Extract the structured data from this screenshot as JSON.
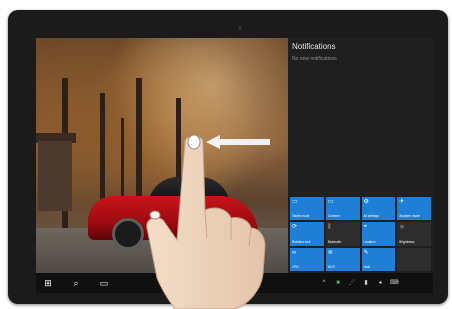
{
  "notifications": {
    "title": "Notifications",
    "empty": "No new notifications"
  },
  "quick_actions": [
    {
      "label": "Tablet mode",
      "icon": "tablet-icon",
      "state": "on"
    },
    {
      "label": "Connect",
      "icon": "connect-icon",
      "state": "on"
    },
    {
      "label": "All settings",
      "icon": "settings-icon",
      "state": "on"
    },
    {
      "label": "Airplane mode",
      "icon": "airplane-icon",
      "state": "on"
    },
    {
      "label": "Rotation lock",
      "icon": "rotation-lock-icon",
      "state": "on"
    },
    {
      "label": "Bluetooth",
      "icon": "bluetooth-icon",
      "state": "off"
    },
    {
      "label": "Location",
      "icon": "location-icon",
      "state": "on"
    },
    {
      "label": "Brightness",
      "icon": "brightness-icon",
      "state": "off"
    },
    {
      "label": "VPN",
      "icon": "vpn-icon",
      "state": "on"
    },
    {
      "label": "Wi-Fi",
      "icon": "wifi-icon",
      "state": "on"
    },
    {
      "label": "Note",
      "icon": "note-icon",
      "state": "on"
    }
  ],
  "taskbar": {
    "start_icon": "windows-start-icon",
    "search_icon": "search-icon",
    "task_view_icon": "task-view-icon",
    "clock_time": "",
    "clock_date": ""
  },
  "colors": {
    "tile_active": "#1f7fd6",
    "tile_inactive": "#2d2d2d",
    "pane_bg": "#1f1f1f",
    "taskbar_bg": "#101010"
  }
}
